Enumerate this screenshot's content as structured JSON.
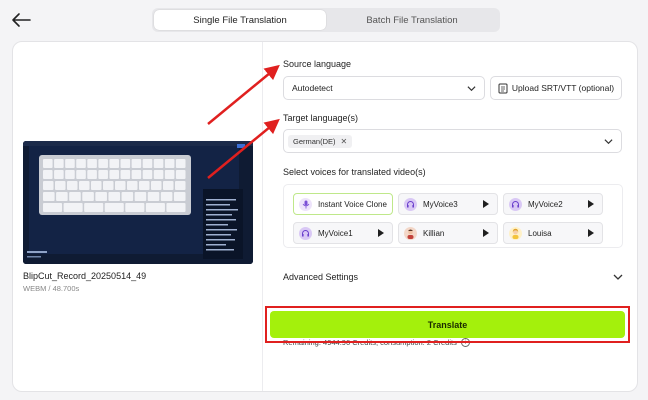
{
  "header": {
    "back_icon": "arrow-left-icon",
    "tabs": [
      {
        "label": "Single File Translation",
        "active": true
      },
      {
        "label": "Batch File Translation",
        "active": false
      }
    ]
  },
  "video": {
    "file_name": "BlipCut_Record_20250514_49",
    "meta": "WEBM / 48.700s"
  },
  "source_language": {
    "label": "Source language",
    "value": "Autodetect",
    "upload_label": "Upload SRT/VTT (optional)"
  },
  "target_language": {
    "label": "Target language(s)",
    "tags": [
      "German(DE)"
    ]
  },
  "voices": {
    "label": "Select voices for translated video(s)",
    "items": [
      {
        "name": "Instant Voice Clone",
        "selected": true,
        "icon": "microphone-icon"
      },
      {
        "name": "MyVoice3",
        "selected": false,
        "icon": "headphones-avatar-icon"
      },
      {
        "name": "MyVoice2",
        "selected": false,
        "icon": "headphones-avatar-icon"
      },
      {
        "name": "MyVoice1",
        "selected": false,
        "icon": "headphones-avatar-icon"
      },
      {
        "name": "Killian",
        "selected": false,
        "icon": "person-avatar-icon"
      },
      {
        "name": "Louisa",
        "selected": false,
        "icon": "person-avatar-icon"
      }
    ]
  },
  "advanced": {
    "label": "Advanced Settings"
  },
  "credits": {
    "text": "Remaining: 4944.96 Credits; consumption: 2 Credits"
  },
  "translate": {
    "label": "Translate"
  },
  "colors": {
    "accent": "#a4f00c",
    "highlight": "#e0201f"
  }
}
